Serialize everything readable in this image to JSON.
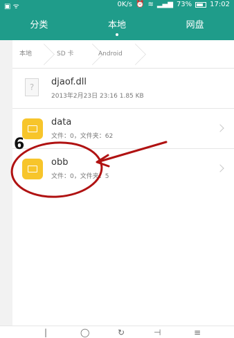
{
  "statusbar": {
    "net_speed": "0K/s",
    "battery": "73%",
    "battery_fraction": 0.73,
    "time": "17:02"
  },
  "tabs": [
    {
      "label": "分类"
    },
    {
      "label": "本地"
    },
    {
      "label": "网盘"
    }
  ],
  "breadcrumb": {
    "items": [
      "本地",
      "SD 卡",
      "Android"
    ]
  },
  "files": [
    {
      "name": "djaof.dll",
      "meta": "2013年2月23日 23:16 1.85 KB",
      "type": "file"
    },
    {
      "name": "data",
      "meta": "文件：0，文件夹：62",
      "type": "folder"
    },
    {
      "name": "obb",
      "meta": "文件：0，文件夹：5",
      "type": "folder"
    }
  ],
  "annotation": {
    "number": "6",
    "color": "#b01212"
  },
  "colors": {
    "accent": "#1f9c8a",
    "folder": "#f7c52b"
  },
  "icons": {
    "file": "file-icon",
    "folder": "folder-icon",
    "chevron": "chevron-right-icon"
  }
}
